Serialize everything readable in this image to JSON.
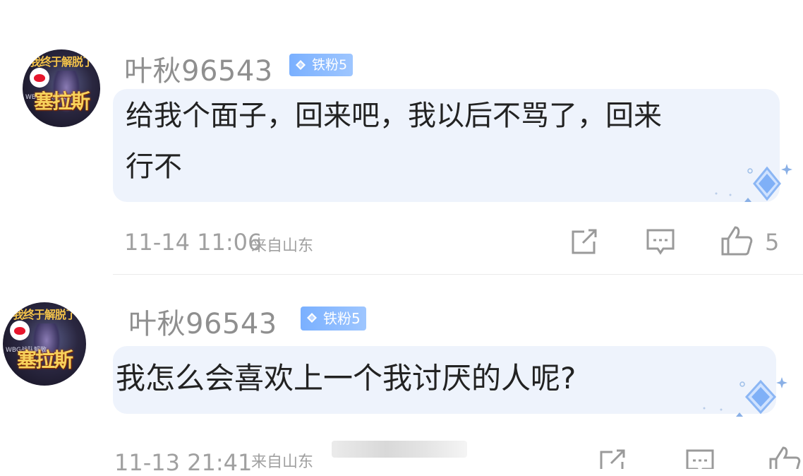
{
  "comments": [
    {
      "username": "叶秋96543",
      "badge": "铁粉5",
      "avatar": {
        "top_text": "我终于解脱了",
        "mid_text": "WBG战队解散",
        "big_text": "塞拉斯"
      },
      "text_line1": "给我个面子，回来吧，我以后不骂了，回来",
      "text_line2": "行不",
      "time": "11-14 11:06",
      "location": "来自山东",
      "likes": "5",
      "icons": [
        "share-icon",
        "comment-icon",
        "like-icon"
      ]
    },
    {
      "username": "叶秋96543",
      "badge": "铁粉5",
      "avatar": {
        "top_text": "我终于解脱了",
        "mid_text": "WBG战队解散",
        "big_text": "塞拉斯"
      },
      "text_line1": "我怎么会喜欢上一个我讨厌的人呢?",
      "time": "11-13 21:41",
      "location": "来自山东",
      "icons": [
        "share-icon",
        "comment-icon",
        "like-icon"
      ]
    }
  ],
  "colors": {
    "badge": "#8ab8ff",
    "bubble": "#eef3fc",
    "meta_text": "#a0a0a0",
    "username": "#8f8f8f"
  }
}
